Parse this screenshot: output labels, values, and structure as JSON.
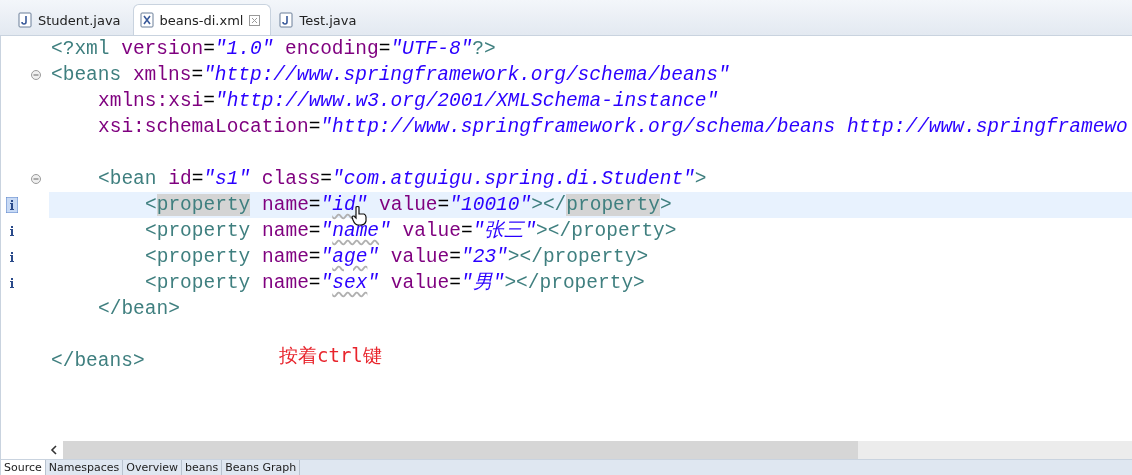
{
  "editor_tabs": [
    {
      "label": "Student.java",
      "kind": "java",
      "selected": false
    },
    {
      "label": "beans-di.xml",
      "kind": "xml",
      "selected": true
    },
    {
      "label": "Test.java",
      "kind": "java",
      "selected": false
    }
  ],
  "lines": [
    {
      "fold": false,
      "info": false,
      "current": false,
      "tokens": [
        {
          "kind": "tag",
          "text": "<?xml "
        },
        {
          "kind": "attr",
          "text": "version"
        },
        {
          "kind": "eq",
          "text": "="
        },
        {
          "kind": "value",
          "text": "\"1.0\""
        },
        {
          "kind": "attr",
          "text": " encoding"
        },
        {
          "kind": "eq",
          "text": "="
        },
        {
          "kind": "value",
          "text": "\"UTF-8\""
        },
        {
          "kind": "tag",
          "text": "?>"
        }
      ]
    },
    {
      "fold": true,
      "info": false,
      "current": false,
      "tokens": [
        {
          "kind": "tag",
          "text": "<beans "
        },
        {
          "kind": "attr",
          "text": "xmlns"
        },
        {
          "kind": "eq",
          "text": "="
        },
        {
          "kind": "value",
          "text": "\"http://www.springframework.org/schema/beans\""
        }
      ],
      "children": [
        {
          "fold": false,
          "info": false,
          "current": false,
          "tokens": [
            {
              "kind": "attr",
              "text": "xmlns:xsi"
            },
            {
              "kind": "eq",
              "text": "="
            },
            {
              "kind": "value",
              "text": "\"http://www.w3.org/2001/XMLSchema-instance\""
            }
          ]
        },
        {
          "fold": false,
          "info": false,
          "current": false,
          "tokens": [
            {
              "kind": "attr",
              "text": "xsi:schemaLocation"
            },
            {
              "kind": "eq",
              "text": "="
            },
            {
              "kind": "value",
              "text": "\"http://www.springframework.org/schema/beans http://www.springframewo"
            }
          ]
        },
        {
          "fold": false,
          "info": false,
          "current": false
        },
        {
          "fold": true,
          "info": false,
          "current": false,
          "tokens": [
            {
              "kind": "tag",
              "text": "<bean "
            },
            {
              "kind": "attr",
              "text": "id"
            },
            {
              "kind": "eq",
              "text": "="
            },
            {
              "kind": "value",
              "text": "\"s1\""
            },
            {
              "kind": "attr",
              "text": " class"
            },
            {
              "kind": "eq",
              "text": "="
            },
            {
              "kind": "value",
              "text": "\"com.atguigu.spring.di.Student\""
            },
            {
              "kind": "tag",
              "text": ">"
            }
          ],
          "children": [
            {
              "fold": false,
              "info": true,
              "current": true,
              "tokens": [
                {
                  "kind": "tag",
                  "text": "<"
                },
                {
                  "kind": "tag",
                  "text": "property",
                  "marked": true
                },
                {
                  "kind": "attr",
                  "text": " name"
                },
                {
                  "kind": "eq",
                  "text": "="
                },
                {
                  "kind": "value",
                  "text": "\""
                },
                {
                  "kind": "value",
                  "text": "id",
                  "spell": true
                },
                {
                  "kind": "value",
                  "text": "\""
                },
                {
                  "kind": "attr",
                  "text": " value"
                },
                {
                  "kind": "eq",
                  "text": "="
                },
                {
                  "kind": "value",
                  "text": "\"10010\""
                },
                {
                  "kind": "tag",
                  "text": "></"
                },
                {
                  "kind": "tag",
                  "text": "property",
                  "marked": true
                },
                {
                  "kind": "tag",
                  "text": ">"
                }
              ]
            },
            {
              "fold": false,
              "info": true,
              "current": false,
              "tokens": [
                {
                  "kind": "tag",
                  "text": "<property "
                },
                {
                  "kind": "attr",
                  "text": "name"
                },
                {
                  "kind": "eq",
                  "text": "="
                },
                {
                  "kind": "value",
                  "text": "\""
                },
                {
                  "kind": "value",
                  "text": "name",
                  "spell": true
                },
                {
                  "kind": "value",
                  "text": "\""
                },
                {
                  "kind": "attr",
                  "text": " value"
                },
                {
                  "kind": "eq",
                  "text": "="
                },
                {
                  "kind": "value",
                  "text": "\"张三\""
                },
                {
                  "kind": "tag",
                  "text": "></property>"
                }
              ]
            },
            {
              "fold": false,
              "info": true,
              "current": false,
              "tokens": [
                {
                  "kind": "tag",
                  "text": "<property "
                },
                {
                  "kind": "attr",
                  "text": "name"
                },
                {
                  "kind": "eq",
                  "text": "="
                },
                {
                  "kind": "value",
                  "text": "\""
                },
                {
                  "kind": "value",
                  "text": "age",
                  "spell": true
                },
                {
                  "kind": "value",
                  "text": "\""
                },
                {
                  "kind": "attr",
                  "text": " value"
                },
                {
                  "kind": "eq",
                  "text": "="
                },
                {
                  "kind": "value",
                  "text": "\"23\""
                },
                {
                  "kind": "tag",
                  "text": "></property>"
                }
              ]
            },
            {
              "fold": false,
              "info": true,
              "current": false,
              "tokens": [
                {
                  "kind": "tag",
                  "text": "<property "
                },
                {
                  "kind": "attr",
                  "text": "name"
                },
                {
                  "kind": "eq",
                  "text": "="
                },
                {
                  "kind": "value",
                  "text": "\""
                },
                {
                  "kind": "value",
                  "text": "sex",
                  "spell": true
                },
                {
                  "kind": "value",
                  "text": "\""
                },
                {
                  "kind": "attr",
                  "text": " value"
                },
                {
                  "kind": "eq",
                  "text": "="
                },
                {
                  "kind": "value",
                  "text": "\"男\""
                },
                {
                  "kind": "tag",
                  "text": "></property>"
                }
              ]
            }
          ]
        },
        {
          "fold": false,
          "info": false,
          "current": false,
          "tokens": [
            {
              "kind": "tag",
              "text": "</bean>"
            }
          ]
        }
      ]
    },
    {
      "fold": false,
      "info": false,
      "current": false
    },
    {
      "fold": false,
      "info": false,
      "current": false,
      "tokens": [
        {
          "kind": "tag",
          "text": "</beans>"
        }
      ]
    }
  ],
  "annotation": "按着ctrl键",
  "bottom_tabs": [
    {
      "label": "Source",
      "selected": true
    },
    {
      "label": "Namespaces",
      "selected": false
    },
    {
      "label": "Overview",
      "selected": false
    },
    {
      "label": "beans",
      "selected": false
    },
    {
      "label": "Beans Graph",
      "selected": false
    }
  ]
}
